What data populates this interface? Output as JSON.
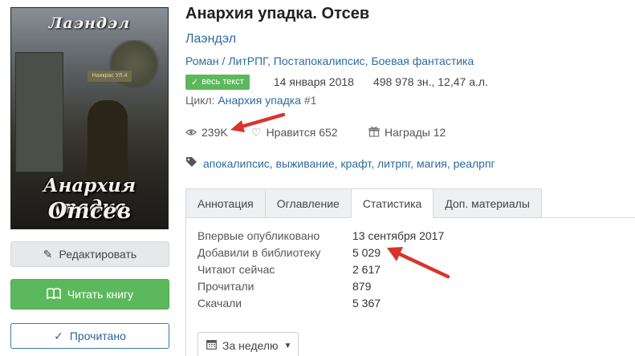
{
  "cover": {
    "author": "Лаэндэл",
    "title_line1": "Анархия упадка",
    "title_line2": "Отсев",
    "sign": "Наикрас УЛ.4"
  },
  "actions": {
    "edit_label": "Редактировать",
    "read_label": "Читать книгу",
    "done_label": "Прочитано"
  },
  "book": {
    "title": "Анархия упадка. Отсев",
    "author": "Лаэндэл",
    "genres": [
      "Роман / ЛитРПГ",
      "Постапокалипсис",
      "Боевая фантастика"
    ],
    "badge": "весь текст",
    "date": "14 января 2018",
    "size": "498 978 зн., 12,47 а.л.",
    "cycle_label": "Цикл:",
    "cycle_name": "Анархия упадка",
    "cycle_num": "#1"
  },
  "stats": {
    "views": "239K",
    "likes": "Нравится 652",
    "awards": "Награды 12"
  },
  "tags": [
    "апокалипсис",
    "выживание",
    "крафт",
    "литрпг",
    "магия",
    "реалрпг"
  ],
  "tabs": [
    "Аннотация",
    "Оглавление",
    "Статистика",
    "Доп. материалы"
  ],
  "statistics": [
    {
      "label": "Впервые опубликовано",
      "value": "13 сентября 2017"
    },
    {
      "label": "Добавили в библиотеку",
      "value": "5 029"
    },
    {
      "label": "Читают сейчас",
      "value": "2 617"
    },
    {
      "label": "Прочитали",
      "value": "879"
    },
    {
      "label": "Скачали",
      "value": "5 367"
    }
  ],
  "period": {
    "label": "За неделю"
  },
  "colors": {
    "accent": "#2d6aa0",
    "green": "#5cb85c",
    "arrow": "#d9342b"
  }
}
